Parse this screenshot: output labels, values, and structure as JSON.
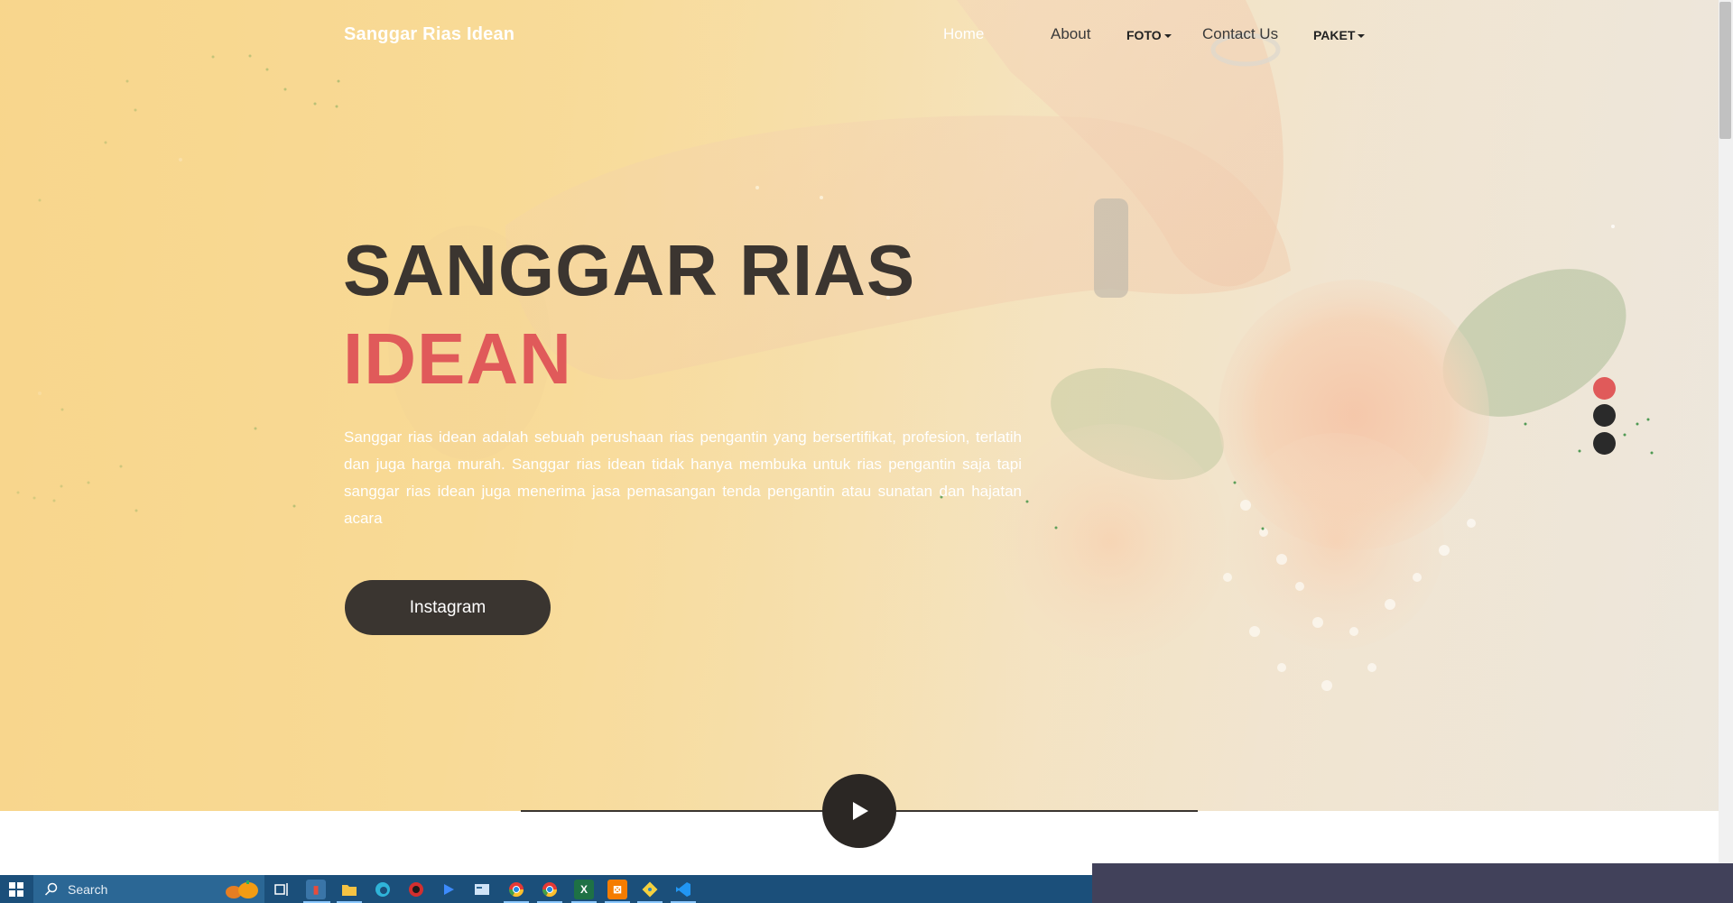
{
  "nav": {
    "brand": "Sanggar Rias Idean",
    "home": "Home",
    "about": "About",
    "foto": "FOTO",
    "contact": "Contact Us",
    "paket": "PAKET"
  },
  "hero": {
    "title_line1": "SANGGAR RIAS",
    "title_line2": "IDEAN",
    "description": "Sanggar rias idean adalah sebuah perushaan rias pengantin yang bersertifikat, profesion, terlatih dan juga harga murah. Sanggar rias idean tidak hanya membuka untuk rias pengantin saja tapi sanggar rias idean juga menerima jasa pemasangan tenda pengantin atau sunatan dan hajatan acara",
    "button_label": "Instagram",
    "slider_dots": 3,
    "active_dot": 0
  },
  "colors": {
    "accent": "#e05a5a",
    "dark": "#3a3530"
  },
  "taskbar": {
    "search_placeholder": "Search",
    "icons": [
      "windows-start-icon",
      "search-icon",
      "task-view-icon",
      "app-icon",
      "file-explorer-icon",
      "edge-icon",
      "app-red-icon",
      "media-player-icon",
      "app-window-icon",
      "chrome-icon",
      "chrome-icon",
      "excel-icon",
      "xampp-icon",
      "git-icon",
      "vscode-icon"
    ]
  }
}
